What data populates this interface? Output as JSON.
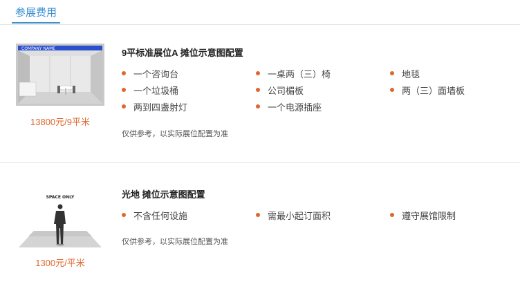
{
  "section_tab": {
    "label": "参展费用"
  },
  "booths": [
    {
      "title": "9平标准展位A 摊位示意图配置",
      "price": "13800元/9平米",
      "image_banner_text": "COMPANY NAME",
      "features": [
        "一个咨询台",
        "一桌两（三）椅",
        "地毯",
        "一个垃圾桶",
        "公司楣板",
        "两（三）面墙板",
        "两到四盏射灯",
        "一个电源插座"
      ],
      "note": "仅供参考，以实际展位配置为准"
    },
    {
      "title": "光地 摊位示意图配置",
      "price": "1300元/平米",
      "image_banner_text": "SPACE ONLY",
      "features": [
        "不含任何设施",
        "需最小起订面积",
        "遵守展馆限制"
      ],
      "note": "仅供参考，以实际展位配置为准"
    }
  ],
  "colors": {
    "accent_blue": "#3a8fd1",
    "accent_orange": "#e0662e",
    "divider": "#e6e6e6"
  }
}
